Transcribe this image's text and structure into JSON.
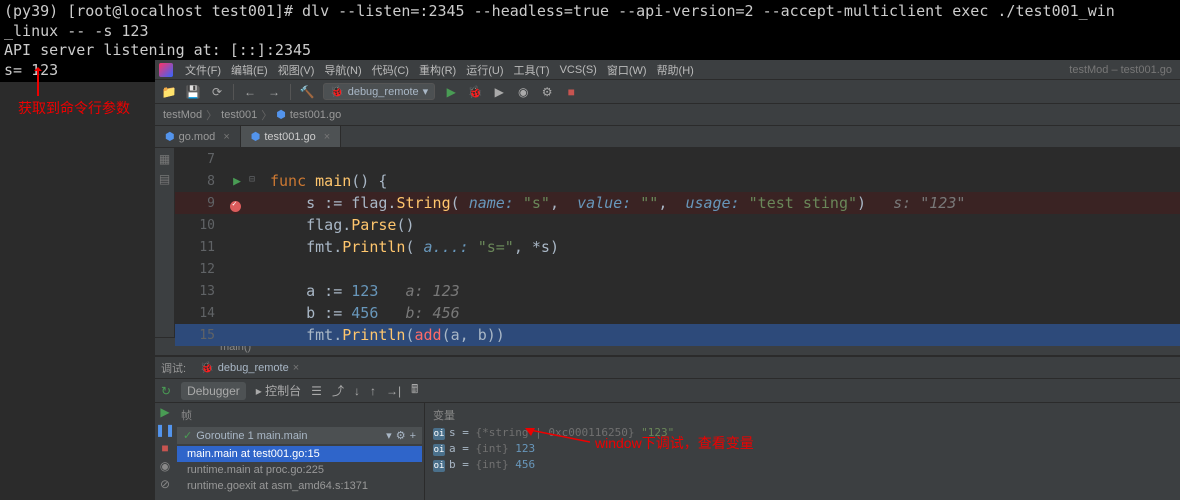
{
  "terminal": {
    "line1": "(py39) [root@localhost test001]# dlv --listen=:2345 --headless=true --api-version=2 --accept-multiclient exec ./test001_win",
    "line2": "_linux -- -s 123",
    "line3": "API server listening at: [::]:2345",
    "line4": "s= 123"
  },
  "annotation1": "获取到命令行参数",
  "menu": {
    "items": [
      "文件(F)",
      "编辑(E)",
      "视图(V)",
      "导航(N)",
      "代码(C)",
      "重构(R)",
      "运行(U)",
      "工具(T)",
      "VCS(S)",
      "窗口(W)",
      "帮助(H)"
    ],
    "path": "testMod – test001.go"
  },
  "toolbar": {
    "runcfg": "debug_remote"
  },
  "breadcrumb": [
    "testMod",
    "test001",
    "test001.go"
  ],
  "tabs": [
    {
      "label": "go.mod",
      "active": false
    },
    {
      "label": "test001.go",
      "active": true
    }
  ],
  "code": {
    "start": 7,
    "lines": [
      {
        "n": 7,
        "html": ""
      },
      {
        "n": 8,
        "play": true,
        "collapse": true,
        "html": "<span class='kw'>func</span> <span class='fn'>main</span>() {"
      },
      {
        "n": 9,
        "bp": true,
        "html": "    s := flag.<span class='fn'>String</span>( <span class='param'>name:</span> <span class='str'>\"s\"</span>,  <span class='param'>value:</span> <span class='str'>\"\"</span>,  <span class='param'>usage:</span> <span class='str'>\"test sting\"</span>)   <span class='hint'>s: \"123\"</span>"
      },
      {
        "n": 10,
        "html": "    flag.<span class='fn'>Parse</span>()"
      },
      {
        "n": 11,
        "html": "    fmt.<span class='fn'>Println</span>( <span class='param'>a...:</span> <span class='str'>\"s=\"</span>, *s)"
      },
      {
        "n": 12,
        "html": ""
      },
      {
        "n": 13,
        "html": "    a := <span class='num'>123</span>   <span class='hint'>a: 123</span>"
      },
      {
        "n": 14,
        "html": "    b := <span class='num'>456</span>   <span class='hint'>b: 456</span>"
      },
      {
        "n": 15,
        "exec": true,
        "html": "    fmt.<span class='fn'>Println</span>(<span style='color:#ff6b68'>add</span>(a, b))"
      }
    ]
  },
  "crumb_fn": "main()",
  "debug": {
    "title": "调试:",
    "tab": "debug_remote",
    "subtabs": {
      "debugger": "Debugger",
      "console": "控制台"
    },
    "frames_hdr": "帧",
    "vars_hdr": "变量",
    "goroutine": "Goroutine 1 main.main",
    "frames": [
      {
        "text": "main.main at test001.go:15",
        "sel": true
      },
      {
        "text": "runtime.main at proc.go:225"
      },
      {
        "text": "runtime.goexit at asm_amd64.s:1371"
      }
    ],
    "vars": [
      {
        "name": "s",
        "type": "{*string | 0xc000116250}",
        "val": "\"123\"",
        "str": true
      },
      {
        "name": "a",
        "type": "{int}",
        "val": "123"
      },
      {
        "name": "b",
        "type": "{int}",
        "val": "456"
      }
    ]
  },
  "annotation2": "window下调试，查看变量"
}
